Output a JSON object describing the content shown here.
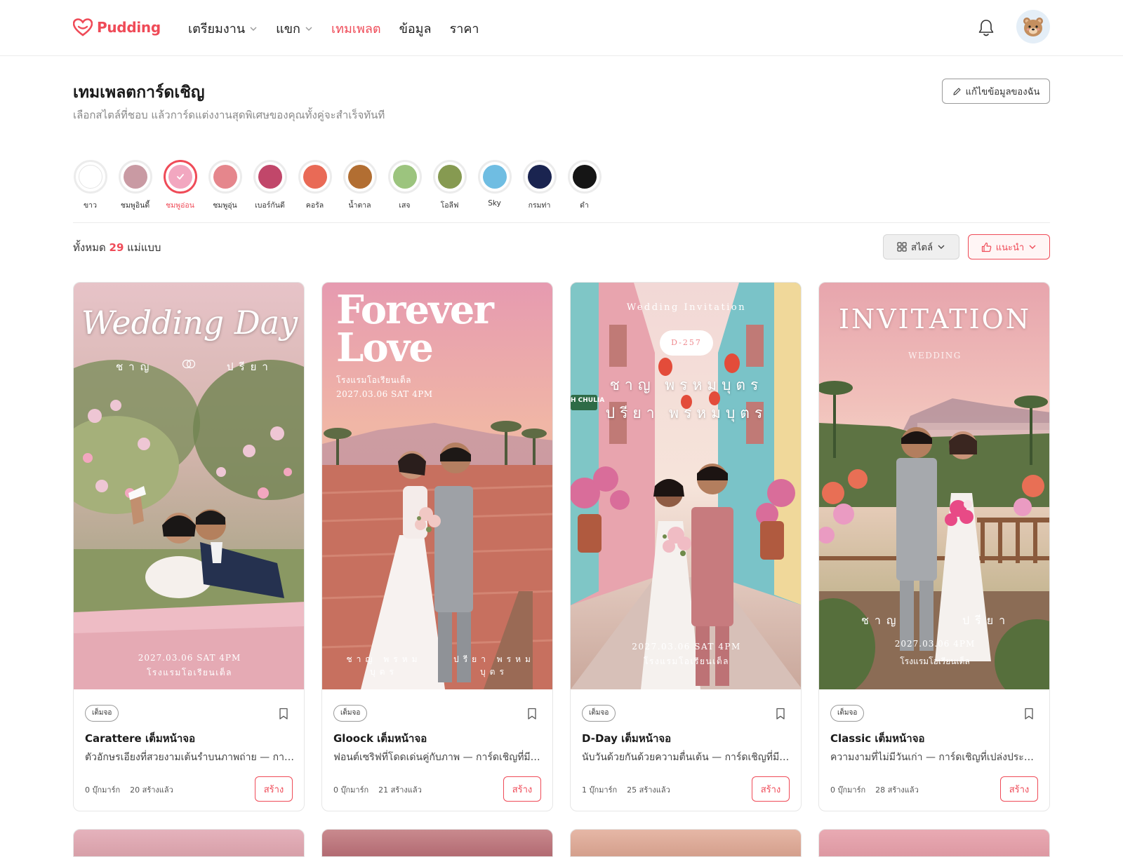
{
  "brand": {
    "name": "Pudding",
    "accent": "#ef4b58"
  },
  "nav": [
    {
      "label": "เตรียมงาน",
      "dropdown": true,
      "active": false
    },
    {
      "label": "แขก",
      "dropdown": true,
      "active": false
    },
    {
      "label": "เทมเพลต",
      "dropdown": false,
      "active": true
    },
    {
      "label": "ข้อมูล",
      "dropdown": false,
      "active": false
    },
    {
      "label": "ราคา",
      "dropdown": false,
      "active": false
    }
  ],
  "header": {
    "title": "เทมเพลตการ์ดเชิญ",
    "subtitle": "เลือกสไตล์ที่ชอบ แล้วการ์ดแต่งงานสุดพิเศษของคุณทั้งคู่จะสำเร็จทันที",
    "edit_label": "แก้ไขข้อมูลของฉัน"
  },
  "colors": [
    {
      "label": "ขาว",
      "hex": "#ffffff",
      "selected": false
    },
    {
      "label": "ชมพูอินดี้",
      "hex": "#c99aa3",
      "selected": false
    },
    {
      "label": "ชมพูอ่อน",
      "hex": "#f2a7c0",
      "selected": true
    },
    {
      "label": "ชมพูอุ่น",
      "hex": "#e5868c",
      "selected": false
    },
    {
      "label": "เบอร์กันดี",
      "hex": "#c1476a",
      "selected": false
    },
    {
      "label": "คอรัล",
      "hex": "#e96a56",
      "selected": false
    },
    {
      "label": "น้ำตาล",
      "hex": "#b26e32",
      "selected": false
    },
    {
      "label": "เสจ",
      "hex": "#9cc47e",
      "selected": false
    },
    {
      "label": "โอลีฟ",
      "hex": "#869a51",
      "selected": false
    },
    {
      "label": "Sky",
      "hex": "#6fbde2",
      "selected": false
    },
    {
      "label": "กรมท่า",
      "hex": "#1a2450",
      "selected": false
    },
    {
      "label": "ดำ",
      "hex": "#151515",
      "selected": false
    }
  ],
  "results": {
    "prefix": "ทั้งหมด",
    "count": "29",
    "suffix": "แม่แบบ"
  },
  "filters": {
    "style_label": "สไตล์",
    "sort_label": "แนะนำ"
  },
  "cards": [
    {
      "tag": "เต็มจอ",
      "title": "Carattere เต็มหน้าจอ",
      "desc": "ตัวอักษรเอียงที่สวยงามเต้นรำบนภาพถ่าย — การ์ดเชิญที่หรูหรา",
      "bookmarks": "0 บุ๊กมาร์ก",
      "created": "20 สร้างแล้ว",
      "create_label": "สร้าง",
      "img": {
        "headline": "Wedding Day",
        "groom": "ชาญ",
        "bride": "ปรียา",
        "date": "2027.03.06 SAT 4PM",
        "venue": "โรงแรมโอเรียนเต็ล"
      }
    },
    {
      "tag": "เต็มจอ",
      "title": "Gloock เต็มหน้าจอ",
      "desc": "ฟอนต์เซริฟที่โดดเด่นคู่กับภาพ — การ์ดเชิญที่มีเอกลักษณ์",
      "bookmarks": "0 บุ๊กมาร์ก",
      "created": "21 สร้างแล้ว",
      "create_label": "สร้าง",
      "img": {
        "headline_1": "Forever",
        "headline_2": "Love",
        "venue": "โรงแรมโอเรียนเต็ล",
        "date": "2027.03.06 SAT 4PM",
        "groom": "ชาญ พรหม",
        "groom_2": "บุตร",
        "bride": "ปรียา พรหม",
        "bride_2": "บุตร"
      }
    },
    {
      "tag": "เต็มจอ",
      "title": "D-Day เต็มหน้าจอ",
      "desc": "นับวันด้วยกันด้วยความตื่นเต้น — การ์ดเชิญที่มีชีวิตชีวา",
      "bookmarks": "1 บุ๊กมาร์ก",
      "created": "25 สร้างแล้ว",
      "create_label": "สร้าง",
      "img": {
        "headline": "Wedding Invitation",
        "dday": "D-257",
        "groom": "ชาญ พรหมบุตร",
        "bride": "ปรียา พรหมบุตร",
        "date": "2027.03.06 SAT 4PM",
        "venue": "โรงแรมโอเรียนเต็ล",
        "sign": "H CHULIA"
      }
    },
    {
      "tag": "เต็มจอ",
      "title": "Classic เต็มหน้าจอ",
      "desc": "ความงามที่ไม่มีวันเก่า — การ์ดเชิญที่เปล่งประกาย",
      "bookmarks": "0 บุ๊กมาร์ก",
      "created": "28 สร้างแล้ว",
      "create_label": "สร้าง",
      "img": {
        "headline": "INVITATION",
        "sub": "WEDDING",
        "groom": "ชาญ",
        "bride": "ปรียา",
        "date": "2027.03.06 4PM",
        "venue": "โรงแรมโอเรียนเต็ล"
      }
    }
  ]
}
